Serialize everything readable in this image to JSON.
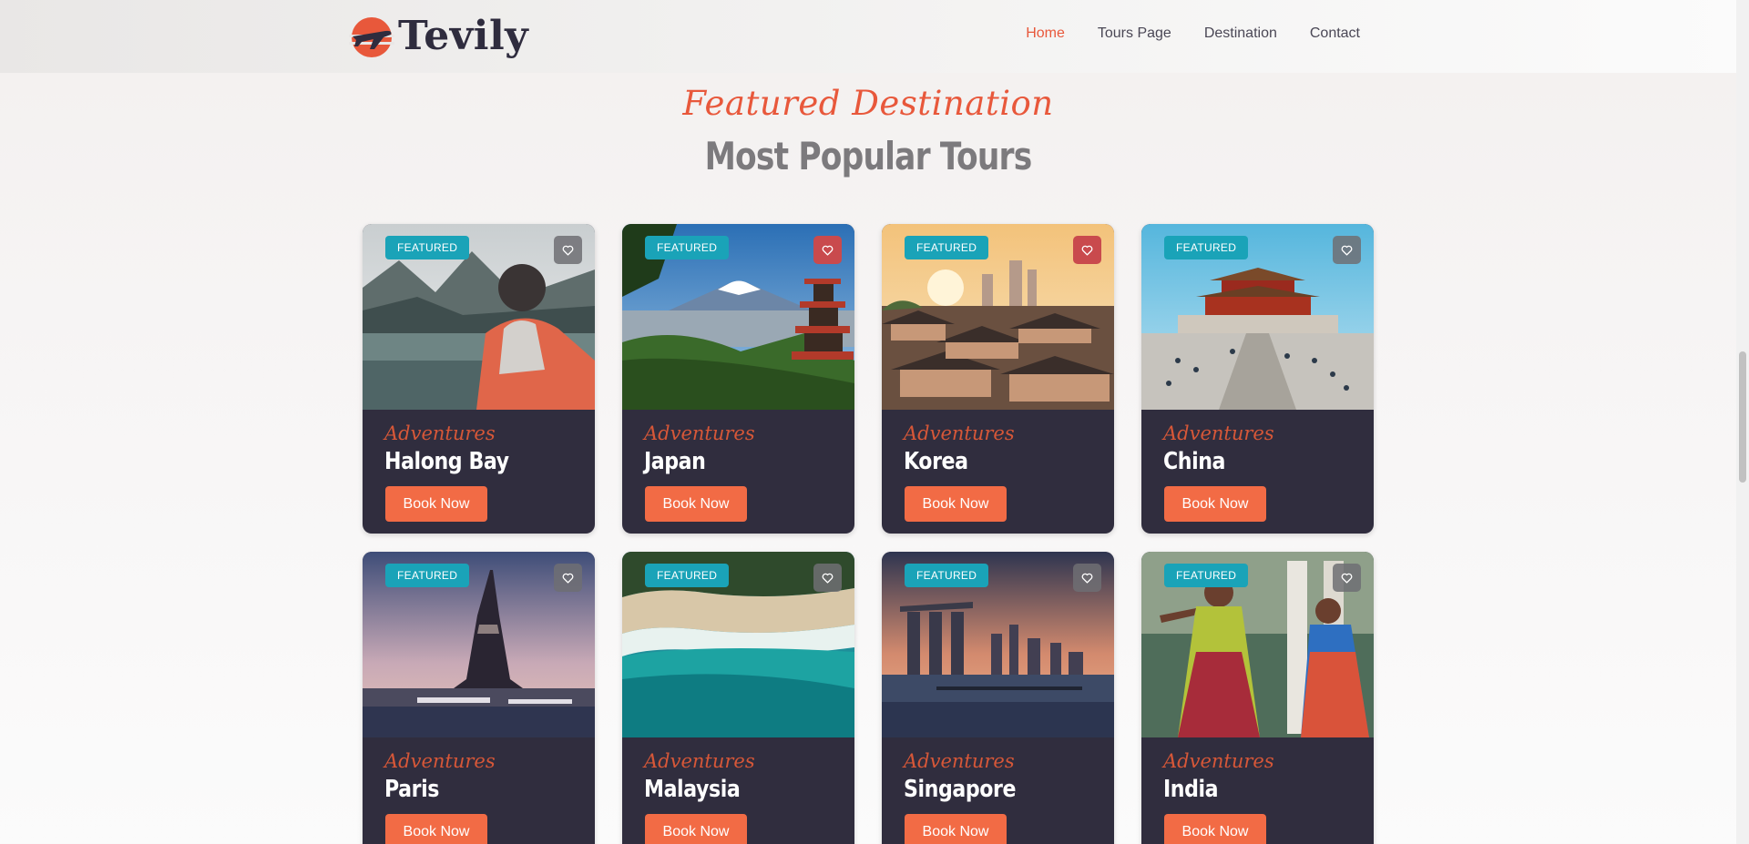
{
  "brand": {
    "name": "Tevily"
  },
  "nav": {
    "items": [
      "Home",
      "Tours Page",
      "Destination",
      "Contact"
    ],
    "active": "Home"
  },
  "section": {
    "subtitle": "Featured Destination",
    "title": "Most Popular Tours"
  },
  "cards": [
    {
      "badge": "FEATURED",
      "tagline": "Adventures",
      "place": "Halong Bay",
      "button": "Book Now",
      "liked": false,
      "scene": "lake"
    },
    {
      "badge": "FEATURED",
      "tagline": "Adventures",
      "place": "Japan",
      "button": "Book Now",
      "liked": true,
      "scene": "fuji"
    },
    {
      "badge": "FEATURED",
      "tagline": "Adventures",
      "place": "Korea",
      "button": "Book Now",
      "liked": true,
      "scene": "village"
    },
    {
      "badge": "FEATURED",
      "tagline": "Adventures",
      "place": "China",
      "button": "Book Now",
      "liked": false,
      "scene": "palace"
    },
    {
      "badge": "FEATURED",
      "tagline": "Adventures",
      "place": "Paris",
      "button": "Book Now",
      "liked": false,
      "scene": "eiffel"
    },
    {
      "badge": "FEATURED",
      "tagline": "Adventures",
      "place": "Malaysia",
      "button": "Book Now",
      "liked": false,
      "scene": "beach"
    },
    {
      "badge": "FEATURED",
      "tagline": "Adventures",
      "place": "Singapore",
      "button": "Book Now",
      "liked": false,
      "scene": "city"
    },
    {
      "badge": "FEATURED",
      "tagline": "Adventures",
      "place": "India",
      "button": "Book Now",
      "liked": false,
      "scene": "dance"
    }
  ],
  "colors": {
    "accent": "#e8583b",
    "button": "#f26b45",
    "badge": "#1aa3b8",
    "card": "#302d3e"
  },
  "icons": {
    "favorite": "heart-icon",
    "logo": "airplane-logo-icon"
  }
}
